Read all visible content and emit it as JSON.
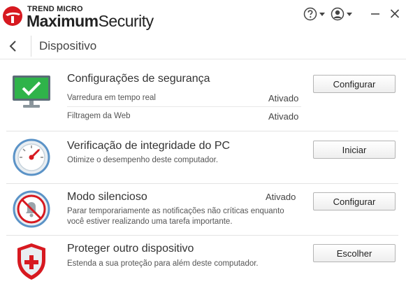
{
  "app": {
    "brand_top": "TREND MICRO",
    "brand_bold": "Maximum",
    "brand_light": "Security",
    "brand_color": "#d71920"
  },
  "header": {
    "help_icon": "question-circle-icon",
    "account_icon": "user-circle-icon",
    "minimize_icon": "minimize-icon",
    "close_icon": "close-icon"
  },
  "page": {
    "back_icon": "chevron-left-icon",
    "title": "Dispositivo"
  },
  "features": [
    {
      "icon": "monitor-check-icon",
      "title": "Configurações de segurança",
      "subrows": [
        {
          "label": "Varredura em tempo real",
          "status": "Ativado"
        },
        {
          "label": "Filtragem da Web",
          "status": "Ativado"
        }
      ],
      "button": "Configurar"
    },
    {
      "icon": "speedometer-icon",
      "title": "Verificação de integridade do PC",
      "desc": "Otimize o desempenho deste computador.",
      "button": "Iniciar"
    },
    {
      "icon": "silent-bell-icon",
      "title": "Modo silencioso",
      "status": "Ativado",
      "desc_lines": [
        "Parar temporariamente as notificações não críticas enquanto",
        "você estiver realizando uma tarefa importante."
      ],
      "button": "Configurar"
    },
    {
      "icon": "shield-plus-icon",
      "title": "Proteger outro dispositivo",
      "desc": "Estenda a sua proteção para além deste computador.",
      "button": "Escolher"
    }
  ],
  "colors": {
    "accent_green": "#2fb34a",
    "accent_red": "#d71920",
    "icon_ring": "#5b93c7"
  }
}
